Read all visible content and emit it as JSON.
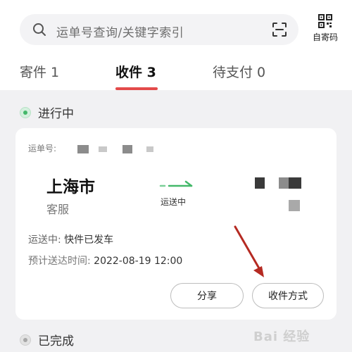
{
  "search": {
    "placeholder": "运单号查询/关键字索引",
    "left_icon": "search-icon",
    "right_icon": "scan-icon"
  },
  "qr": {
    "label": "自寄码",
    "icon": "qr-code-icon"
  },
  "tabs": [
    {
      "label": "寄件 1",
      "active": false
    },
    {
      "label": "收件 3",
      "active": true
    },
    {
      "label": "待支付 0",
      "active": false
    }
  ],
  "colors": {
    "accent": "#e34a4a",
    "in_progress": "#43b869",
    "background": "#f1f1f3"
  },
  "sections": {
    "in_progress": "进行中",
    "completed": "已完成"
  },
  "card": {
    "waybill_label": "运单号:",
    "from_city": "上海市",
    "from_sub": "客服",
    "transit_label": "运送中",
    "status_key": "运送中:",
    "status_value": "快件已发车",
    "eta_key": "预计送达时间:",
    "eta_value": "2022-08-19 12:00",
    "buttons": {
      "share": "分享",
      "method": "收件方式"
    }
  },
  "watermark": {
    "text": "Bai 经验"
  }
}
